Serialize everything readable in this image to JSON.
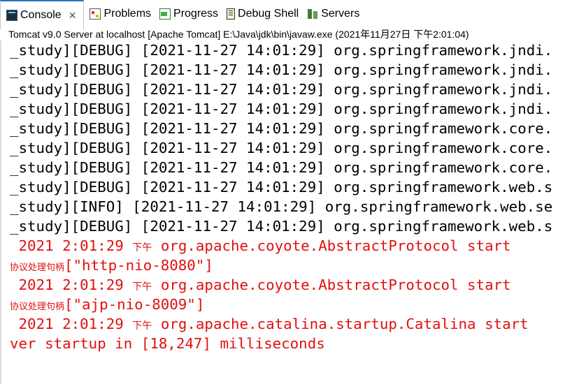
{
  "tabs": [
    {
      "label": "Console",
      "icon": "console-icon",
      "active": true
    },
    {
      "label": "Problems",
      "icon": "problems-icon",
      "active": false
    },
    {
      "label": "Progress",
      "icon": "progress-icon",
      "active": false
    },
    {
      "label": "Debug Shell",
      "icon": "debug-shell-icon",
      "active": false
    },
    {
      "label": "Servers",
      "icon": "servers-icon",
      "active": false
    }
  ],
  "close_glyph": "✕",
  "console_title": "Tomcat v9.0 Server at localhost [Apache Tomcat] E:\\Java\\jdk\\bin\\javaw.exe (2021年11月27日 下午2:01:04)",
  "lines": [
    {
      "text": "_study][DEBUG] [2021-11-27 14:01:29] org.springframework.jndi.",
      "color": "black"
    },
    {
      "text": "_study][DEBUG] [2021-11-27 14:01:29] org.springframework.jndi.",
      "color": "black"
    },
    {
      "text": "_study][DEBUG] [2021-11-27 14:01:29] org.springframework.jndi.",
      "color": "black"
    },
    {
      "text": "_study][DEBUG] [2021-11-27 14:01:29] org.springframework.jndi.",
      "color": "black"
    },
    {
      "text": "_study][DEBUG] [2021-11-27 14:01:29] org.springframework.core.",
      "color": "black"
    },
    {
      "text": "_study][DEBUG] [2021-11-27 14:01:29] org.springframework.core.",
      "color": "black"
    },
    {
      "text": "_study][DEBUG] [2021-11-27 14:01:29] org.springframework.core.",
      "color": "black"
    },
    {
      "text": "_study][DEBUG] [2021-11-27 14:01:29] org.springframework.web.s",
      "color": "black"
    },
    {
      "text": "_study][INFO] [2021-11-27 14:01:29] org.springframework.web.se",
      "color": "black"
    },
    {
      "text": "_study][DEBUG] [2021-11-27 14:01:29] org.springframework.web.s",
      "color": "black"
    },
    {
      "pre": " 2021 2:01:29 ",
      "cjk": "下午",
      "post": " org.apache.coyote.AbstractProtocol start",
      "color": "red"
    },
    {
      "cjk_lead": "协议处理句柄",
      "post": "[\"http-nio-8080\"]",
      "color": "red"
    },
    {
      "pre": " 2021 2:01:29 ",
      "cjk": "下午",
      "post": " org.apache.coyote.AbstractProtocol start",
      "color": "red"
    },
    {
      "cjk_lead": "协议处理句柄",
      "post": "[\"ajp-nio-8009\"]",
      "color": "red"
    },
    {
      "pre": " 2021 2:01:29 ",
      "cjk": "下午",
      "post": " org.apache.catalina.startup.Catalina start",
      "color": "red"
    },
    {
      "text": "ver startup in [18,247] milliseconds",
      "color": "red"
    }
  ],
  "colors": {
    "log_black": "#000000",
    "log_red": "#e01010",
    "accent": "#2a6fc0"
  }
}
